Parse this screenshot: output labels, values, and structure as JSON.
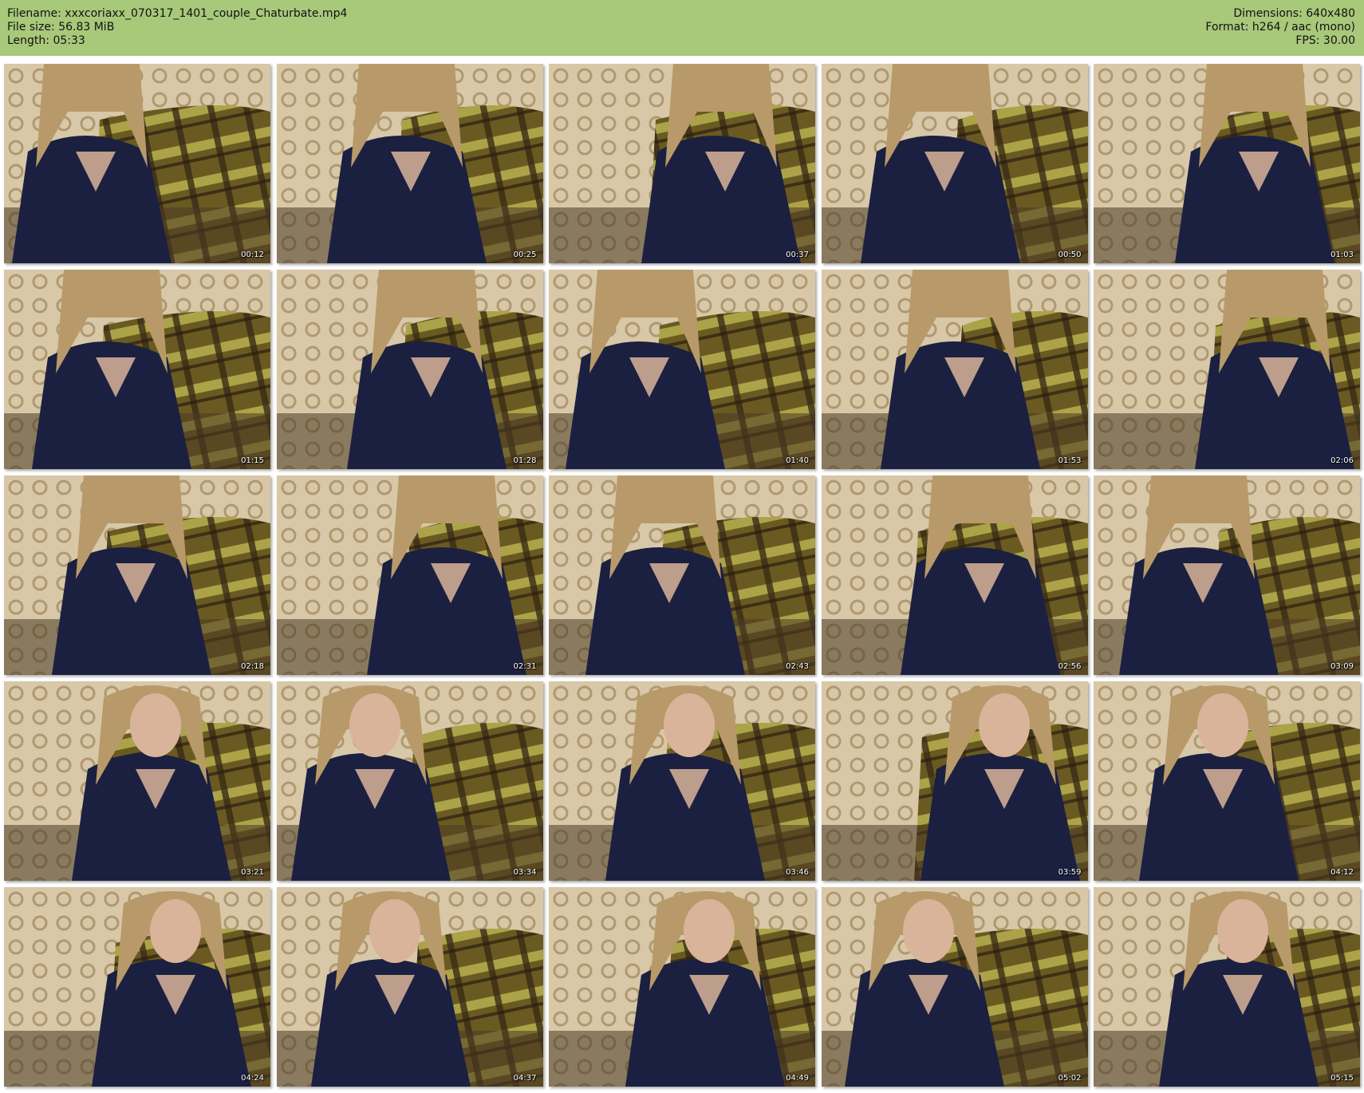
{
  "header": {
    "filename_label": "Filename: xxxcoriaxx_070317_1401_couple_Chaturbate.mp4",
    "filesize_label": "File size: 56.83 MiB",
    "length_label": "Length: 05:33",
    "dimensions_label": "Dimensions: 640x480",
    "format_label": "Format: h264 / aac (mono)",
    "fps_label": "FPS: 30.00"
  },
  "colors": {
    "header_bg": "#a8c87a",
    "shirt": "#1b2040",
    "hair": "#b89a6a",
    "sofa_plaid": "#6a5a22",
    "sofa_yellow": "#b8b050",
    "wall": "#d8c8a8"
  },
  "thumbnails": [
    {
      "time": "00:12"
    },
    {
      "time": "00:25"
    },
    {
      "time": "00:37"
    },
    {
      "time": "00:50"
    },
    {
      "time": "01:03"
    },
    {
      "time": "01:15"
    },
    {
      "time": "01:28"
    },
    {
      "time": "01:40"
    },
    {
      "time": "01:53"
    },
    {
      "time": "02:06"
    },
    {
      "time": "02:18"
    },
    {
      "time": "02:31"
    },
    {
      "time": "02:43"
    },
    {
      "time": "02:56"
    },
    {
      "time": "03:09"
    },
    {
      "time": "03:21"
    },
    {
      "time": "03:34"
    },
    {
      "time": "03:46"
    },
    {
      "time": "03:59"
    },
    {
      "time": "04:12"
    },
    {
      "time": "04:24"
    },
    {
      "time": "04:37"
    },
    {
      "time": "04:49"
    },
    {
      "time": "05:02"
    },
    {
      "time": "05:15"
    }
  ]
}
